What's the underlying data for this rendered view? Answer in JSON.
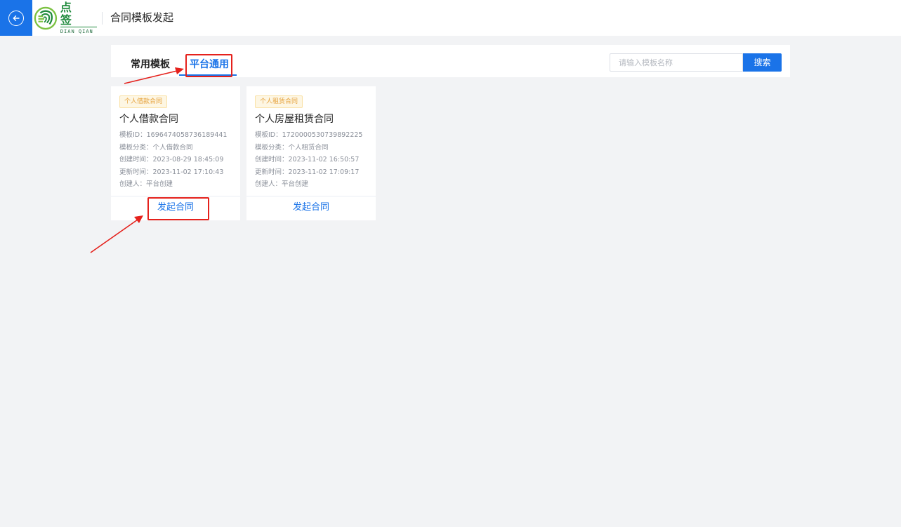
{
  "header": {
    "back_icon": "arrow-left-circle-icon",
    "logo": {
      "cn": "点 签",
      "en": "DIAN QIAN",
      "icon": "fingerprint-logo-icon",
      "color": "#1f8a3c"
    },
    "title": "合同模板发起"
  },
  "tabs": [
    {
      "label": "常用模板",
      "active": false
    },
    {
      "label": "平台通用",
      "active": true
    }
  ],
  "search": {
    "placeholder": "请输入模板名称",
    "value": "",
    "button_label": "搜索"
  },
  "cards": [
    {
      "tag": "个人借款合同",
      "title": "个人借款合同",
      "meta": [
        "模板ID：1696474058736189441",
        "模板分类：个人借款合同",
        "创建时间：2023-08-29 18:45:09",
        "更新时间：2023-11-02 17:10:43",
        "创建人：平台创建"
      ],
      "action": "发起合同"
    },
    {
      "tag": "个人租赁合同",
      "title": "个人房屋租赁合同",
      "meta": [
        "模板ID：1720000530739892225",
        "模板分类：个人租赁合同",
        "创建时间：2023-11-02 16:50:57",
        "更新时间：2023-11-02 17:09:17",
        "创建人：平台创建"
      ],
      "action": "发起合同"
    }
  ],
  "colors": {
    "primary": "#1a73e8",
    "annotation": "#e5211c",
    "tag_text": "#e6a23c",
    "background": "#f2f3f5"
  }
}
